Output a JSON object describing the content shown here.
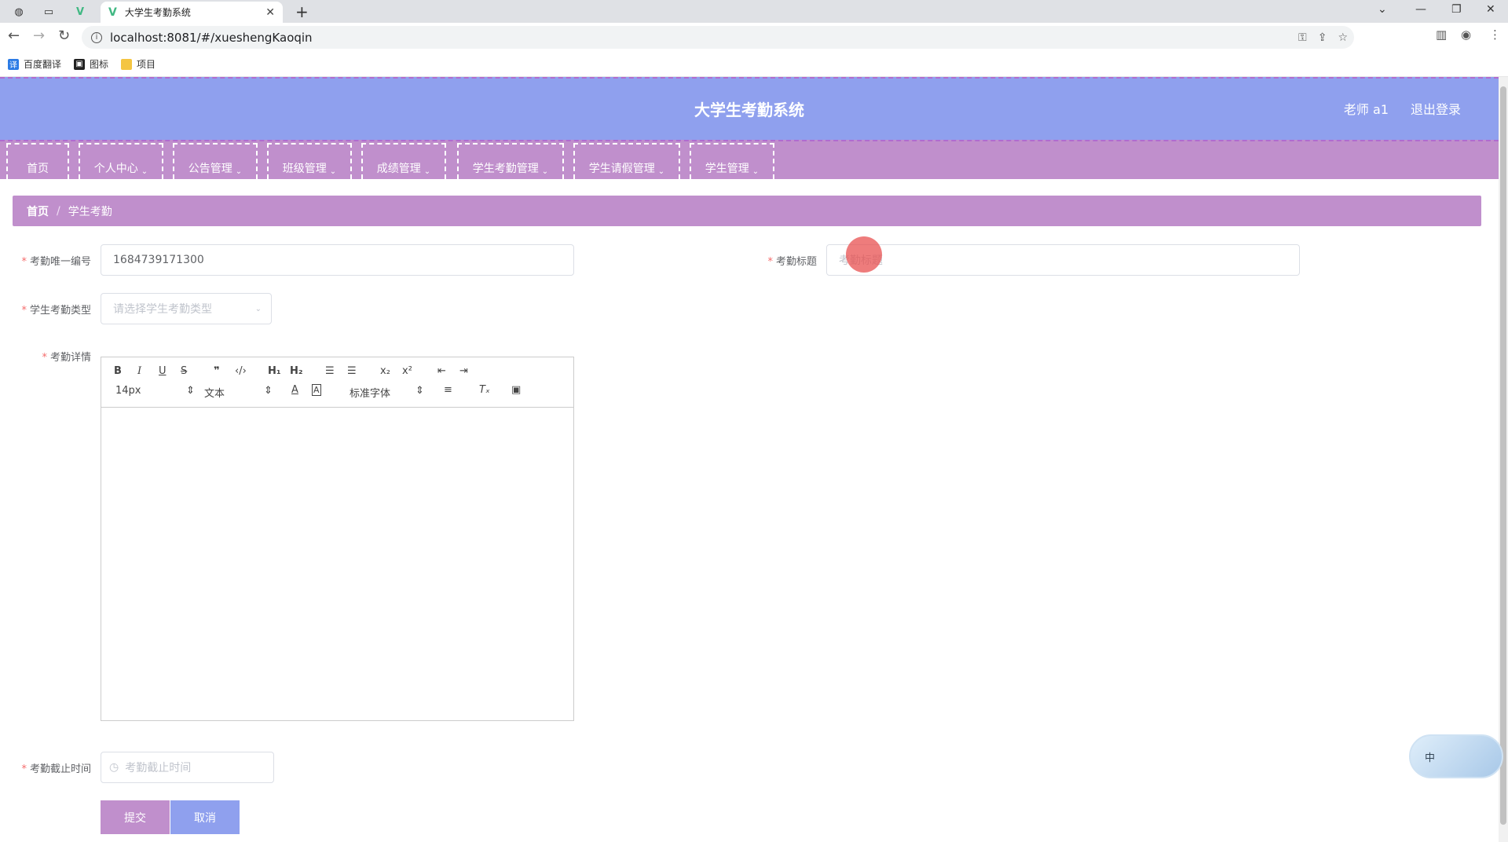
{
  "browser": {
    "tab_title": "大学生考勤系统",
    "url": "localhost:8081/#/xueshengKaoqin",
    "bookmarks": [
      "百度翻译",
      "图标",
      "项目"
    ]
  },
  "header": {
    "title": "大学生考勤系统",
    "user": "老师 a1",
    "logout": "退出登录"
  },
  "menu": [
    {
      "label": "首页"
    },
    {
      "label": "个人中心"
    },
    {
      "label": "公告管理"
    },
    {
      "label": "班级管理"
    },
    {
      "label": "成绩管理"
    },
    {
      "label": "学生考勤管理"
    },
    {
      "label": "学生请假管理"
    },
    {
      "label": "学生管理"
    }
  ],
  "breadcrumb": {
    "home": "首页",
    "current": "学生考勤"
  },
  "form": {
    "id_label": "考勤唯一编号",
    "id_value": "1684739171300",
    "title_label": "考勤标题",
    "title_placeholder": "考勤标题",
    "type_label": "学生考勤类型",
    "type_placeholder": "请选择学生考勤类型",
    "detail_label": "考勤详情",
    "deadline_label": "考勤截止时间",
    "deadline_placeholder": "考勤截止时间"
  },
  "editor": {
    "font_size": "14px",
    "header_select": "文本",
    "font_family": "标准字体"
  },
  "buttons": {
    "submit": "提交",
    "cancel": "取消"
  },
  "ime_widget": "中",
  "colors": {
    "header": "#8fa0ee",
    "menu": "#c08fcc",
    "submit": "#c08fcc",
    "cancel": "#8fa0ee"
  }
}
